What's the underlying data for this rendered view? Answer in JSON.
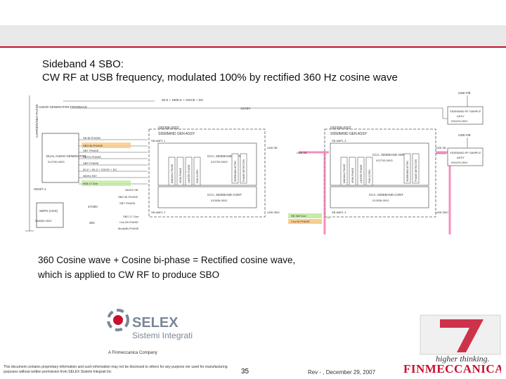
{
  "title": {
    "line1": "Sideband 4 SBO:",
    "line2": "CW RF at USB frequency, modulated 100% by rectified 360 Hz cosine wave"
  },
  "caption": {
    "line1": "360 Cosine wave + Cosine bi-phase = Rectified cosine wave,",
    "line2": "which is applied to CW RF to produce SBO"
  },
  "diagram": {
    "side_label": "CARRIER/SBO PHASE",
    "left_top_label": "AUDIO GENERATOR FEEDBACK",
    "dual_audio": "DUAL AUDIO GENERATOR",
    "dual_audio_ref": "012790-0003",
    "dual_audio_mode": "GEN/7-1",
    "sdps": "SDPS (AGS)",
    "sdps_ref": "058350-0002",
    "v47": "47/48V",
    "v28": "28V",
    "top_eq": "30-Z + 1800-Z + VOICE + DC",
    "top_v": "42/48V",
    "sb_signals": [
      "SB BI-PHASE",
      "SBO BI-PHASE",
      "SBT PHASE",
      "SBP/4 PHASE",
      "SBP PHASE",
      "30-Z + 90-Z + VOICE + DC",
      "360Hz SB+",
      "90B 17 Doe"
    ],
    "mid_signals": [
      "360HZ SB",
      "SBO BI-PHASE",
      "SBT PHASE",
      "SBO 17 Doe",
      "Cos BI-PHASE",
      "Mody/BI-PHASE"
    ],
    "assy1_title": "030398-0002",
    "assy1_sub": "SIDEBAND GEN ASSY",
    "assy2_title": "030398-0002",
    "assy2_sub": "SIDEBAND GEN ASSY",
    "ampl1": "SB AMPL 1",
    "ampl2": "SB AMPL 3",
    "cont1": "SB AMPL 2",
    "cont2": "SB AMPL 4",
    "ssb_amp": "CCA, SIDEBAND AMPL",
    "ssb_amp_ref1": "012793-0003",
    "ssb_amp_ref2": "012793-0003",
    "ssb_cont": "CCA, SIDEBAND CONT",
    "ssb_cont_ref1": "012636-0001",
    "ssb_cont_ref2": "012636-0001",
    "vert_blocks": [
      "MANUAL PHASE",
      "VFAN PHASE",
      "LIMITER PHASE",
      "FWD & REV",
      "SIDEBAND ATTEN",
      "PHASE DETECTOR"
    ],
    "usb_sb": "USB SB",
    "usb_sb_r": "USB SB",
    "usb_sbo": "USB SBO",
    "usb_fb": "USB F/B",
    "usb_fb2": "USB F/B",
    "rf_sample1_title": "SIDEBAND RF SAMPLE",
    "rf_sample1_sub": "ASSY",
    "rf_sample1_ref": "030475-0001",
    "rf_sample2_title": "SIDEBAND RF SAMPLE",
    "rf_sample2_sub": "ASSY",
    "rf_sample2_ref": "030475-0001",
    "usb_sb_pink": "USB SB",
    "sbo_green": "SB 360 Doe",
    "sbo_orange": "Cos BI-PHASE",
    "usb_out": "USB SBO"
  },
  "footer": {
    "company": "SELEX",
    "company_sub": "Sistemi Integrati",
    "tagline": "A Finmeccanica Company",
    "disclaimer": "This document contains proprietary information and such information may not be disclosed to others for any purpose nor used for manufacturing purposes without written permission from SELEX Sistemi Integrati Inc",
    "page": "35",
    "rev": "Rev - , December 29, 2007",
    "slogan": "higher thinking.",
    "brand": "FINMECCANICA"
  },
  "colors": {
    "accent_red": "#c8102e",
    "band_grey": "#e9e9ea",
    "pink": "#f06aa8",
    "green": "#a6e36a",
    "orange": "#f7b84f"
  }
}
